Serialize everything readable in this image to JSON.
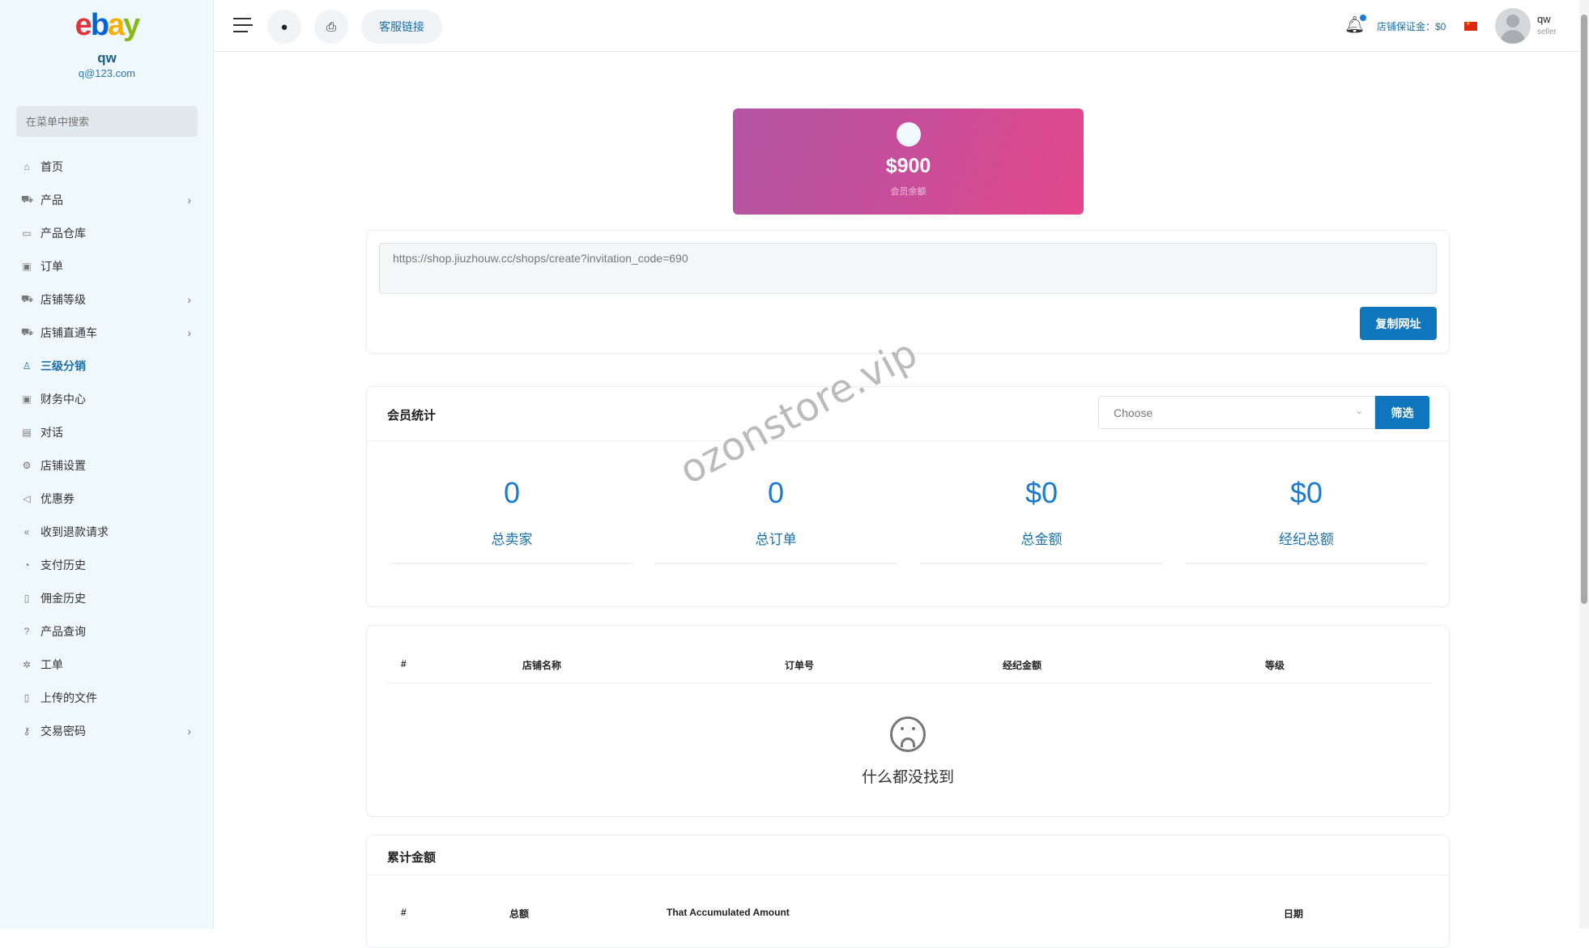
{
  "sidebar": {
    "logo_text": "ebay",
    "user": {
      "name": "qw",
      "email": "q@123.com"
    },
    "search_placeholder": "在菜单中搜索",
    "items": [
      {
        "label": "首页",
        "icon": "home-icon",
        "glyph": "⌂",
        "chevron": false
      },
      {
        "label": "产品",
        "icon": "cart-icon",
        "glyph": "⛟",
        "chevron": true
      },
      {
        "label": "产品仓库",
        "icon": "archive-icon",
        "glyph": "▭",
        "chevron": false
      },
      {
        "label": "订单",
        "icon": "ticket-icon",
        "glyph": "▣",
        "chevron": false
      },
      {
        "label": "店铺等级",
        "icon": "cart-icon",
        "glyph": "⛟",
        "chevron": true
      },
      {
        "label": "店铺直通车",
        "icon": "cart-icon",
        "glyph": "⛟",
        "chevron": true
      },
      {
        "label": "三级分销",
        "icon": "user-icon",
        "glyph": "♙",
        "chevron": false,
        "active": true
      },
      {
        "label": "财务中心",
        "icon": "money-icon",
        "glyph": "▣",
        "chevron": false
      },
      {
        "label": "对话",
        "icon": "message-icon",
        "glyph": "▤",
        "chevron": false
      },
      {
        "label": "店铺设置",
        "icon": "gear-icon",
        "glyph": "⚙",
        "chevron": false
      },
      {
        "label": "优惠券",
        "icon": "megaphone-icon",
        "glyph": "◁",
        "chevron": false
      },
      {
        "label": "收到退款请求",
        "icon": "rewind-icon",
        "glyph": "«",
        "chevron": false
      },
      {
        "label": "支付历史",
        "icon": "history-icon",
        "glyph": "◔",
        "chevron": false
      },
      {
        "label": "佣金历史",
        "icon": "document-icon",
        "glyph": "▯",
        "chevron": false
      },
      {
        "label": "产品查询",
        "icon": "question-icon",
        "glyph": "?",
        "chevron": false
      },
      {
        "label": "工单",
        "icon": "settings-icon",
        "glyph": "✲",
        "chevron": false
      },
      {
        "label": "上传的文件",
        "icon": "file-icon",
        "glyph": "▯",
        "chevron": false
      },
      {
        "label": "交易密码",
        "icon": "key-icon",
        "glyph": "⚷",
        "chevron": true
      }
    ]
  },
  "header": {
    "service_link": "客服链接",
    "deposit_label": "店铺保证金：$0",
    "user_name": "qw",
    "user_role": "seller"
  },
  "balance": {
    "amount": "$900",
    "label": "会员余额"
  },
  "invite": {
    "url": "https://shop.jiuzhouw.cc/shops/create?invitation_code=690",
    "copy_label": "复制网址"
  },
  "member_stats": {
    "title": "会员统计",
    "select_value": "Choose",
    "filter_label": "筛选",
    "stats": [
      {
        "value": "0",
        "label": "总卖家"
      },
      {
        "value": "0",
        "label": "总订单"
      },
      {
        "value": "$0",
        "label": "总金额"
      },
      {
        "value": "$0",
        "label": "经纪总额"
      }
    ]
  },
  "orders_table": {
    "columns": [
      "#",
      "店铺名称",
      "订单号",
      "经纪金额",
      "等级"
    ],
    "empty_text": "什么都没找到"
  },
  "accumulated": {
    "title": "累计金额",
    "columns": [
      "#",
      "总额",
      "That Accumulated Amount",
      "日期"
    ]
  },
  "watermark": "ozonstore.vip",
  "colors": {
    "primary": "#0f75bc",
    "accent_text": "#1a6fa8",
    "balance_gradient_start": "#b355a2",
    "balance_gradient_end": "#e3478a"
  }
}
